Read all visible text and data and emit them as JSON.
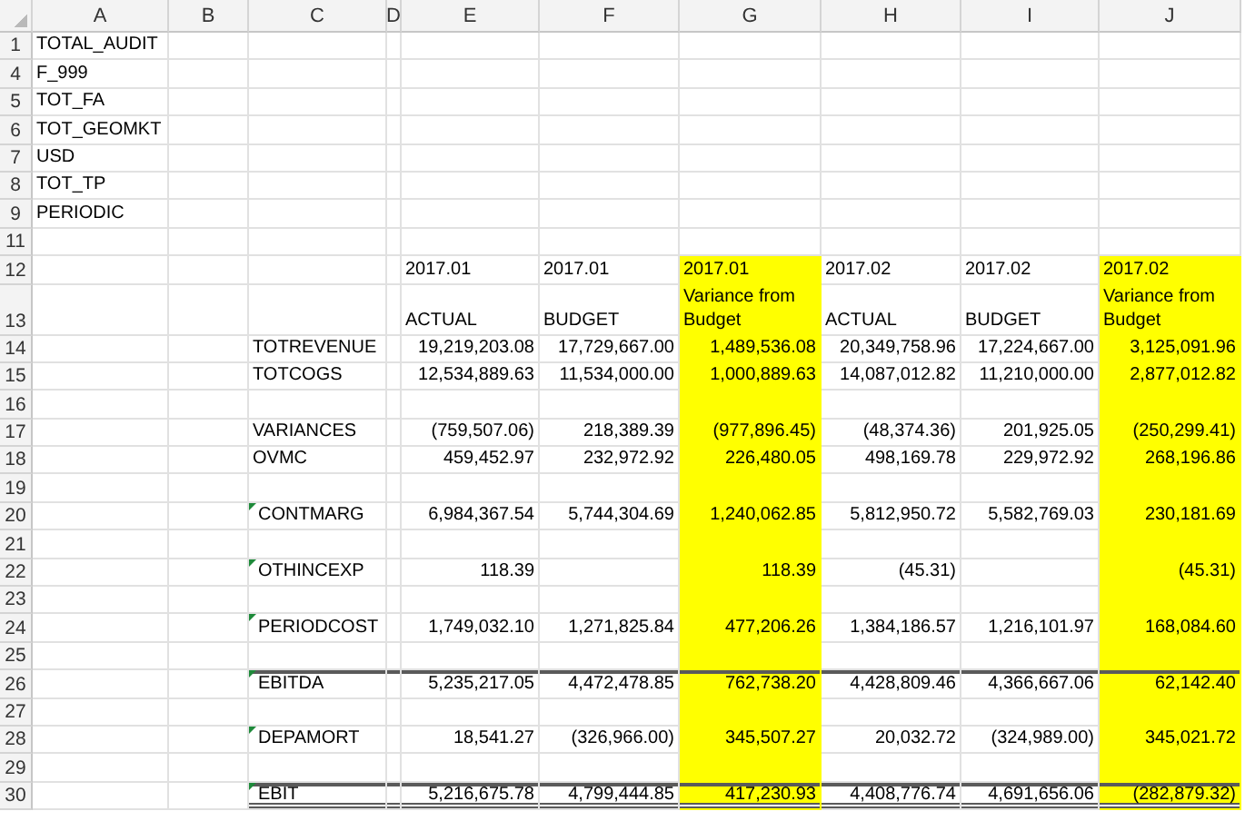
{
  "columns": [
    {
      "letter": "A",
      "highlighted": false
    },
    {
      "letter": "B",
      "highlighted": false
    },
    {
      "letter": "C",
      "highlighted": false
    },
    {
      "letter": "D",
      "highlighted": false
    },
    {
      "letter": "E",
      "highlighted": false
    },
    {
      "letter": "F",
      "highlighted": false
    },
    {
      "letter": "G",
      "highlighted": true
    },
    {
      "letter": "H",
      "highlighted": false
    },
    {
      "letter": "I",
      "highlighted": false
    },
    {
      "letter": "J",
      "highlighted": true
    }
  ],
  "rows": [
    {
      "number": "1",
      "kind": "text",
      "highlighted": false,
      "flagged": false,
      "cells": {
        "a": "TOTAL_AUDIT"
      }
    },
    {
      "number": "4",
      "kind": "text",
      "highlighted": false,
      "flagged": false,
      "cells": {
        "a": "F_999"
      }
    },
    {
      "number": "5",
      "kind": "text",
      "highlighted": false,
      "flagged": false,
      "cells": {
        "a": "TOT_FA"
      }
    },
    {
      "number": "6",
      "kind": "text",
      "highlighted": false,
      "flagged": false,
      "cells": {
        "a": "TOT_GEOMKT"
      }
    },
    {
      "number": "7",
      "kind": "text",
      "highlighted": false,
      "flagged": false,
      "cells": {
        "a": "USD"
      }
    },
    {
      "number": "8",
      "kind": "text",
      "highlighted": false,
      "flagged": false,
      "cells": {
        "a": "TOT_TP"
      }
    },
    {
      "number": "9",
      "kind": "text",
      "highlighted": false,
      "flagged": false,
      "cells": {
        "a": "PERIODIC"
      }
    },
    {
      "number": "11",
      "kind": "text",
      "highlighted": false,
      "flagged": false
    },
    {
      "number": "12",
      "kind": "text",
      "highlighted": true,
      "flagged": false,
      "cells": {
        "e": "2017.01",
        "f": "2017.01",
        "g": "2017.01",
        "h": "2017.02",
        "i": "2017.02",
        "j": "2017.02"
      }
    },
    {
      "number": "13",
      "kind": "text",
      "highlighted": true,
      "flagged": false,
      "cells": {
        "e": "ACTUAL",
        "f": "BUDGET",
        "g": "Variance from Budget",
        "h": "ACTUAL",
        "i": "BUDGET",
        "j": "Variance from Budget"
      }
    },
    {
      "number": "14",
      "kind": "values",
      "highlighted": true,
      "flagged": false,
      "cells": {
        "c": "TOTREVENUE",
        "e": "19,219,203.08",
        "f": "17,729,667.00",
        "g": "1,489,536.08",
        "h": "20,349,758.96",
        "i": "17,224,667.00",
        "j": "3,125,091.96"
      }
    },
    {
      "number": "15",
      "kind": "values",
      "highlighted": true,
      "flagged": false,
      "cells": {
        "c": "TOTCOGS",
        "e": "12,534,889.63",
        "f": "11,534,000.00",
        "g": "1,000,889.63",
        "h": "14,087,012.82",
        "i": "11,210,000.00",
        "j": "2,877,012.82"
      }
    },
    {
      "number": "16",
      "kind": "values",
      "highlighted": true,
      "flagged": false
    },
    {
      "number": "17",
      "kind": "values",
      "highlighted": true,
      "flagged": false,
      "cells": {
        "c": "VARIANCES",
        "e": "(759,507.06)",
        "f": "218,389.39",
        "g": "(977,896.45)",
        "h": "(48,374.36)",
        "i": "201,925.05",
        "j": "(250,299.41)"
      }
    },
    {
      "number": "18",
      "kind": "values",
      "highlighted": true,
      "flagged": false,
      "cells": {
        "c": "OVMC",
        "e": "459,452.97",
        "f": "232,972.92",
        "g": "226,480.05",
        "h": "498,169.78",
        "i": "229,972.92",
        "j": "268,196.86"
      }
    },
    {
      "number": "19",
      "kind": "values",
      "highlighted": true,
      "flagged": false
    },
    {
      "number": "20",
      "kind": "values",
      "highlighted": true,
      "flagged": true,
      "cells": {
        "c": "CONTMARG",
        "e": "6,984,367.54",
        "f": "5,744,304.69",
        "g": "1,240,062.85",
        "h": "5,812,950.72",
        "i": "5,582,769.03",
        "j": "230,181.69"
      }
    },
    {
      "number": "21",
      "kind": "values",
      "highlighted": true,
      "flagged": false
    },
    {
      "number": "22",
      "kind": "values",
      "highlighted": true,
      "flagged": true,
      "cells": {
        "c": "OTHINCEXP",
        "e": "118.39",
        "g": "118.39",
        "h": "(45.31)",
        "j": "(45.31)"
      }
    },
    {
      "number": "23",
      "kind": "values",
      "highlighted": true,
      "flagged": false
    },
    {
      "number": "24",
      "kind": "values",
      "highlighted": true,
      "flagged": true,
      "cells": {
        "c": "PERIODCOST",
        "e": "1,749,032.10",
        "f": "1,271,825.84",
        "g": "477,206.26",
        "h": "1,384,186.57",
        "i": "1,216,101.97",
        "j": "168,084.60"
      }
    },
    {
      "number": "25",
      "kind": "values",
      "highlighted": true,
      "flagged": false
    },
    {
      "number": "26",
      "kind": "subtotal",
      "highlighted": true,
      "flagged": true,
      "cells": {
        "c": "EBITDA",
        "e": "5,235,217.05",
        "f": "4,472,478.85",
        "g": "762,738.20",
        "h": "4,428,809.46",
        "i": "4,366,667.06",
        "j": "62,142.40"
      }
    },
    {
      "number": "27",
      "kind": "values",
      "highlighted": true,
      "flagged": false
    },
    {
      "number": "28",
      "kind": "values",
      "highlighted": true,
      "flagged": true,
      "cells": {
        "c": "DEPAMORT",
        "e": "18,541.27",
        "f": "(326,966.00)",
        "g": "345,507.27",
        "h": "20,032.72",
        "i": "(324,989.00)",
        "j": "345,021.72"
      }
    },
    {
      "number": "29",
      "kind": "values",
      "highlighted": true,
      "flagged": false
    },
    {
      "number": "30",
      "kind": "total",
      "highlighted": true,
      "flagged": true,
      "cells": {
        "c": "EBIT",
        "e": "5,216,675.78",
        "f": "4,799,444.85",
        "g": "417,230.93",
        "h": "4,408,776.74",
        "i": "4,691,656.06",
        "j": "(282,879.32)"
      }
    }
  ]
}
